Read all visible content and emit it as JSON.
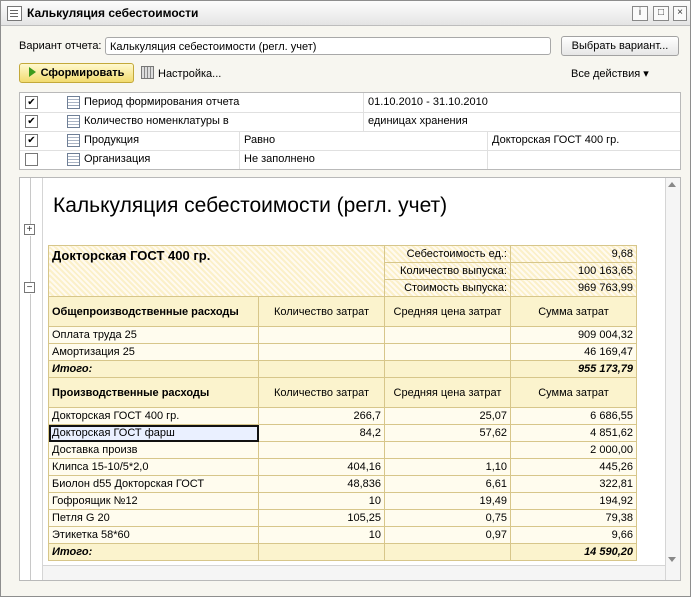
{
  "window": {
    "title": "Калькуляция себестоимости"
  },
  "toolbar": {
    "variant_label": "Вариант отчета:",
    "variant_value": "Калькуляция себестоимости (регл. учет)",
    "select_variant": "Выбрать вариант...",
    "generate": "Сформировать",
    "settings": "Настройка...",
    "all_actions": "Все действия"
  },
  "params": [
    {
      "checked": true,
      "name": "Период формирования отчета",
      "condition": "",
      "value": "01.10.2010 - 31.10.2010"
    },
    {
      "checked": true,
      "name": "Количество номенклатуры в",
      "condition": "",
      "value": "единицах хранения"
    },
    {
      "checked": true,
      "name": "Продукция",
      "condition": "Равно",
      "value": "Докторская ГОСТ 400 гр."
    },
    {
      "checked": false,
      "name": "Организация",
      "condition": "Не заполнено",
      "value": ""
    }
  ],
  "report": {
    "title": "Калькуляция себестоимости (регл. учет)",
    "product": "Докторская ГОСТ 400 гр.",
    "summary": [
      {
        "label": "Себестоимость ед.:",
        "value": "9,68"
      },
      {
        "label": "Количество выпуска:",
        "value": "100 163,65"
      },
      {
        "label": "Стоимость выпуска:",
        "value": "969 763,99"
      }
    ],
    "col_qty": "Количество затрат",
    "col_price": "Средняя цена затрат",
    "col_sum": "Сумма затрат",
    "overhead": {
      "title": "Общепроизводственные расходы",
      "rows": [
        {
          "name": "Оплата труда 25",
          "qty": "",
          "price": "",
          "sum": "909 004,32"
        },
        {
          "name": "Амортизация 25",
          "qty": "",
          "price": "",
          "sum": "46 169,47"
        }
      ],
      "total_label": "Итого:",
      "total": "955 173,79"
    },
    "production": {
      "title": "Производственные расходы",
      "rows": [
        {
          "name": "Докторская ГОСТ 400 гр.",
          "qty": "266,7",
          "price": "25,07",
          "sum": "6 686,55"
        },
        {
          "name": "Докторская ГОСТ фарш",
          "qty": "84,2",
          "price": "57,62",
          "sum": "4 851,62"
        },
        {
          "name": "Доставка произв",
          "qty": "",
          "price": "",
          "sum": "2 000,00"
        },
        {
          "name": "Клипса 15-10/5*2,0",
          "qty": "404,16",
          "price": "1,10",
          "sum": "445,26"
        },
        {
          "name": "Биолон d55 Докторская ГОСТ",
          "qty": "48,836",
          "price": "6,61",
          "sum": "322,81"
        },
        {
          "name": "Гофроящик №12",
          "qty": "10",
          "price": "19,49",
          "sum": "194,92"
        },
        {
          "name": "Петля G 20",
          "qty": "105,25",
          "price": "0,75",
          "sum": "79,38"
        },
        {
          "name": "Этикетка 58*60",
          "qty": "10",
          "price": "0,97",
          "sum": "9,66"
        }
      ],
      "total_label": "Итого:",
      "total": "14 590,20"
    }
  }
}
